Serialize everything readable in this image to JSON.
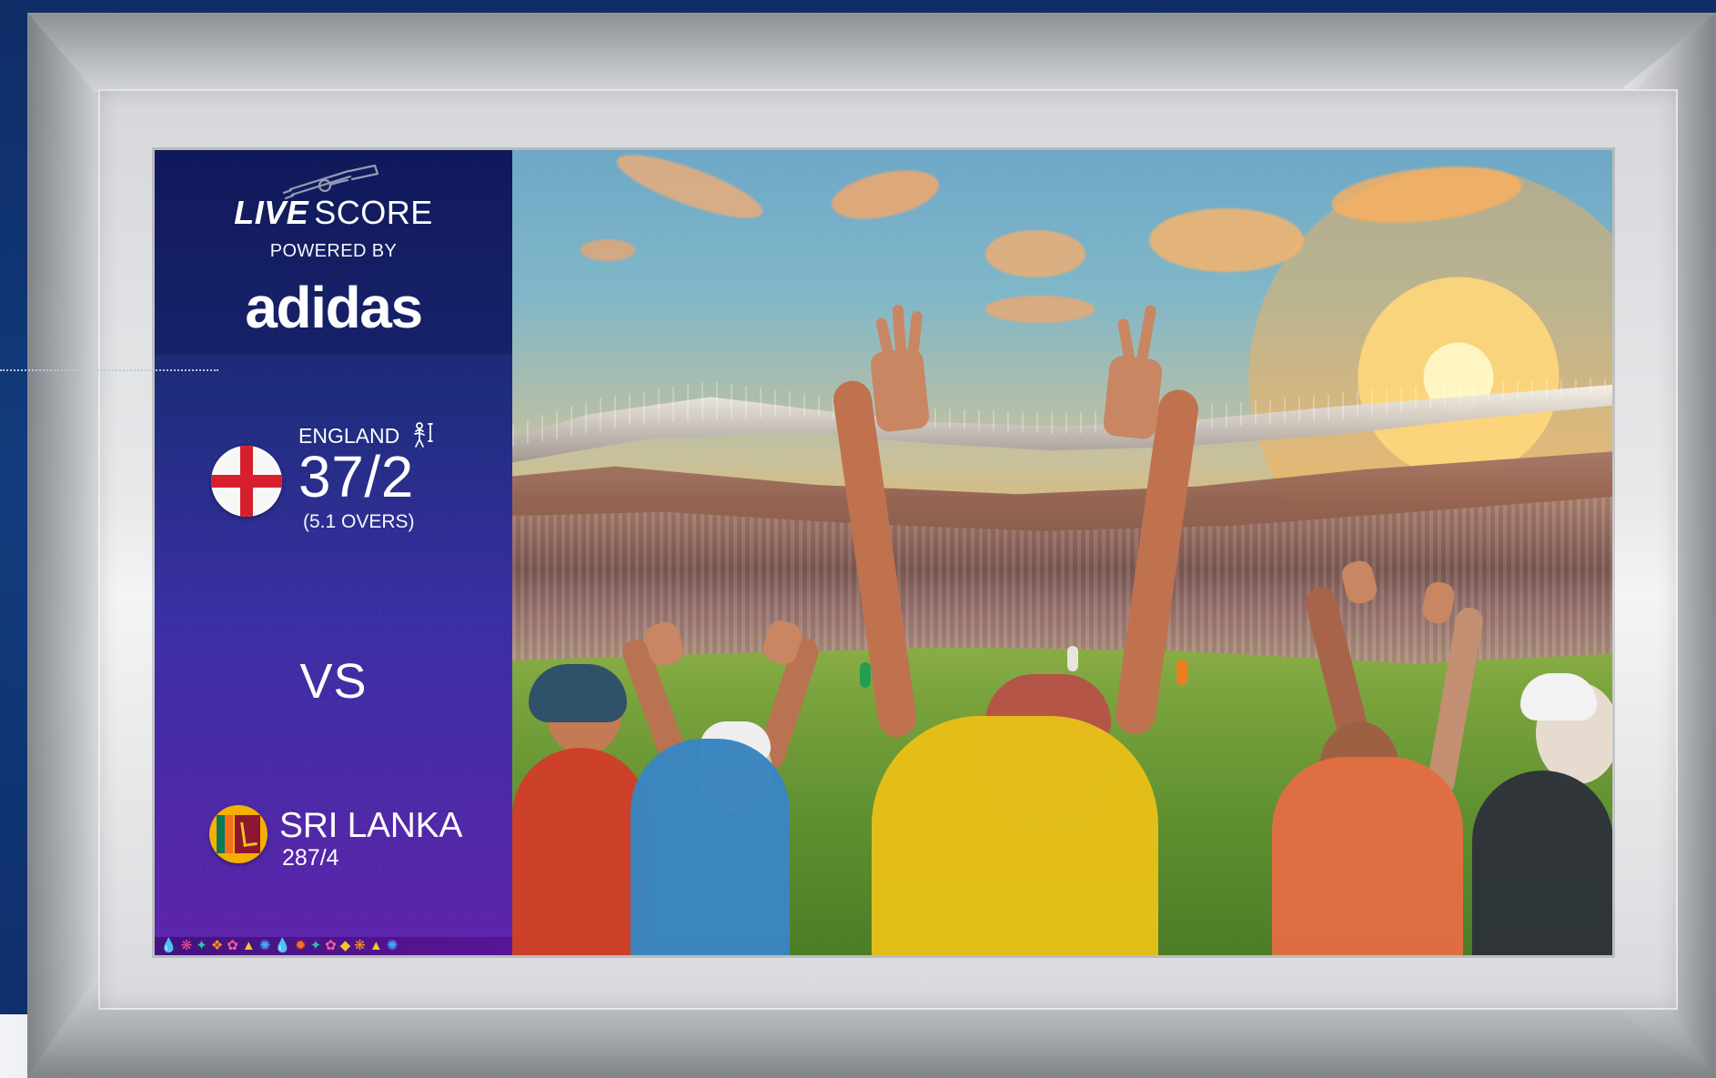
{
  "score_panel": {
    "title_live": "LIVE",
    "title_score": "SCORE",
    "powered_by": "POWERED BY",
    "brand": "adidas",
    "team_top": {
      "name": "ENGLAND",
      "score": "37/2",
      "overs": "(5.1 OVERS)"
    },
    "versus": "VS",
    "team_bottom": {
      "name": "SRI LANKA",
      "score": "287/4"
    },
    "icons": {
      "bat": "cricket-bat-icon",
      "batsman": "batsman-icon",
      "england_flag": "england-flag-icon",
      "sri_lanka_flag": "sri-lanka-flag-icon"
    },
    "pattern_items": [
      "💧",
      "❋",
      "✦",
      "❖",
      "✿",
      "▲",
      "✺",
      "💧",
      "✹",
      "✦",
      "✿",
      "◆",
      "❋",
      "▲",
      "✺"
    ],
    "colors": {
      "panel_top": "#172164",
      "panel_bottom": "#5e24ac",
      "text": "#ffffff",
      "england_red": "#d71f2d",
      "sri_lanka_gold": "#f4b000",
      "sri_lanka_maroon": "#8d1732"
    }
  },
  "scene": {
    "description_icons": [
      "stadium-image",
      "crowd-image",
      "sunset-sky-image"
    ]
  },
  "frame": {
    "colors": {
      "outer_background": "#0f2d67",
      "silver_light": "#f3f4f6",
      "silver_dark": "#8d9094"
    }
  }
}
